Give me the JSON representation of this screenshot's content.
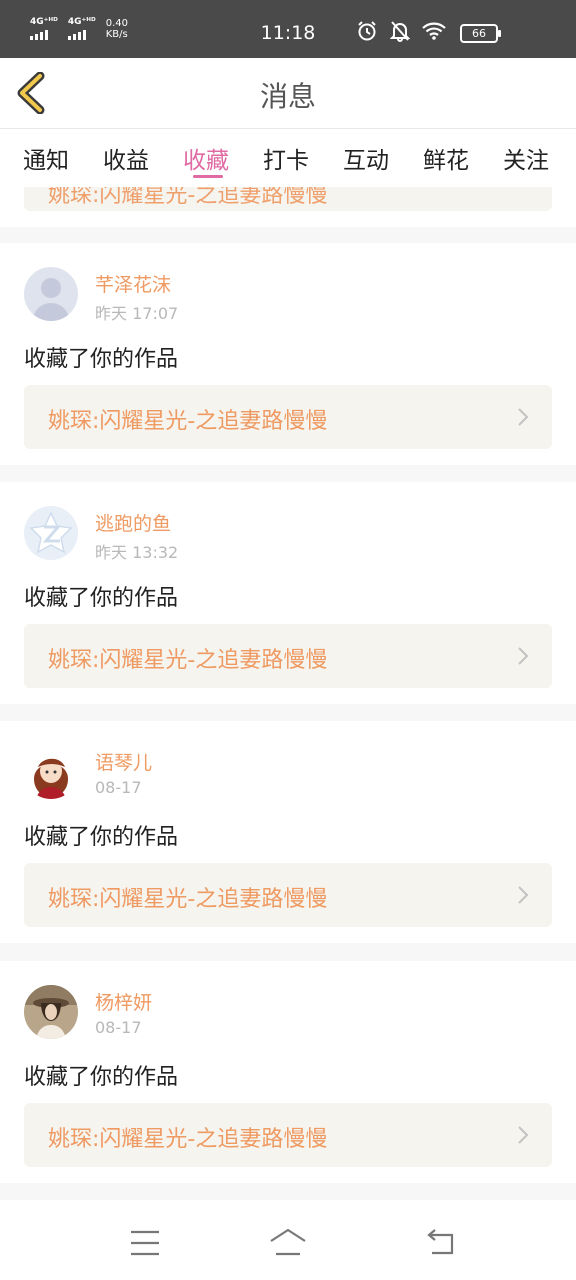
{
  "status_bar": {
    "network_1": "4G⁺ᴴᴰ",
    "network_2": "4G⁺ᴴᴰ",
    "speed_value": "0.40",
    "speed_unit": "KB/s",
    "time": "11:18",
    "battery": "66",
    "icons": [
      "alarm-icon",
      "bell-off-icon",
      "wifi-icon",
      "battery-icon"
    ]
  },
  "header": {
    "title": "消息",
    "back_icon": "chevron-left-icon"
  },
  "tabs": [
    {
      "label": "通知"
    },
    {
      "label": "收益"
    },
    {
      "label": "收藏",
      "active": true
    },
    {
      "label": "打卡"
    },
    {
      "label": "互动"
    },
    {
      "label": "鲜花"
    },
    {
      "label": "关注"
    }
  ],
  "top_partial": {
    "work_title": "姚琛:闪耀星光-之追妻路慢慢"
  },
  "messages": [
    {
      "user": "芊泽花沫",
      "time": "昨天 17:07",
      "action": "收藏了你的作品",
      "work_title": "姚琛:闪耀星光-之追妻路慢慢",
      "avatar": "default-avatar"
    },
    {
      "user": "逃跑的鱼",
      "time": "昨天 13:32",
      "action": "收藏了你的作品",
      "work_title": "姚琛:闪耀星光-之追妻路慢慢",
      "avatar": "qzone-avatar"
    },
    {
      "user": "语琴儿",
      "time": "08-17",
      "action": "收藏了你的作品",
      "work_title": "姚琛:闪耀星光-之追妻路慢慢",
      "avatar": "girl-illustration-avatar"
    },
    {
      "user": "杨梓妍",
      "time": "08-17",
      "action": "收藏了你的作品",
      "work_title": "姚琛:闪耀星光-之追妻路慢慢",
      "avatar": "girl-photo-avatar"
    }
  ],
  "nav_bar": {
    "icons": [
      "menu-icon",
      "home-icon",
      "back-icon"
    ]
  },
  "colors": {
    "accent": "#e06aa4",
    "name": "#ef9a62",
    "card_bg": "#f5f4ee"
  }
}
